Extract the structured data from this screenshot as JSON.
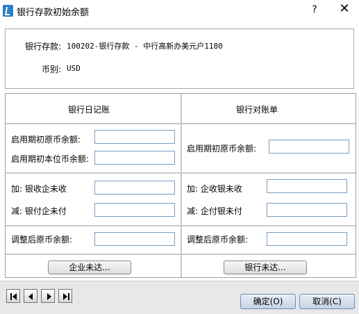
{
  "window": {
    "title": "银行存款初始余额",
    "help": "?",
    "close": "✕"
  },
  "info": {
    "account_label": "银行存款:",
    "account_value": "100202-银行存款 - 中行高新办美元户1180",
    "currency_label": "币别:",
    "currency_value": "USD"
  },
  "left": {
    "header": "银行日记账",
    "opening_orig_label": "启用期初原币余额:",
    "opening_orig_value": "",
    "opening_local_label": "启用期初本位币余额:",
    "opening_local_value": "",
    "bank_received_label": "加: 银收企未收",
    "bank_received_value": "",
    "bank_paid_label": "减: 银付企未付",
    "bank_paid_value": "",
    "adjusted_label": "调整后原币余额:",
    "adjusted_value": "",
    "button": "企业未达..."
  },
  "right": {
    "header": "银行对账单",
    "opening_orig_label": "启用期初原币余额:",
    "opening_orig_value": "",
    "company_received_label": "加: 企收银未收",
    "company_received_value": "",
    "company_paid_label": "减: 企付银未付",
    "company_paid_value": "",
    "adjusted_label": "调整后原币余额:",
    "adjusted_value": "",
    "button": "银行未达..."
  },
  "footer": {
    "ok": "确定(O)",
    "cancel": "取消(C)",
    "nav_icons": [
      "first-record-icon",
      "previous-record-icon",
      "next-record-icon",
      "last-record-icon"
    ]
  }
}
